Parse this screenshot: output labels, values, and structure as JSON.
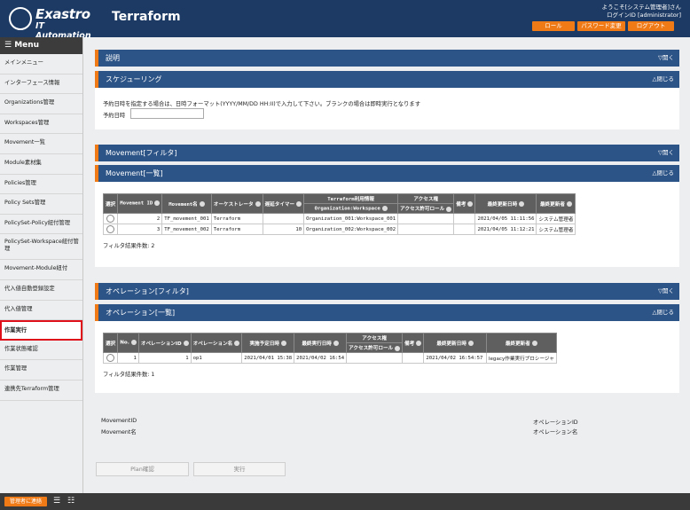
{
  "app": {
    "logo_line1": "Exastro",
    "logo_line2": "IT Automation",
    "title": "Terraform"
  },
  "user": {
    "welcome": "ようこそ[システム管理者]さん",
    "login": "ログインID [administrator]"
  },
  "header_buttons": {
    "role": "ロール",
    "password": "パスワード変更",
    "logout": "ログアウト"
  },
  "menu": {
    "title": "Menu",
    "items": [
      "メインメニュー",
      "インターフェース情報",
      "Organizations管理",
      "Workspaces管理",
      "Movement一覧",
      "Module素材集",
      "Policies管理",
      "Policy Sets管理",
      "PolicySet-Policy紐付管理",
      "PolicySet-Workspace紐付管理",
      "Movement-Module紐付",
      "代入値自動登録設定",
      "代入値管理",
      "作業実行",
      "作業状態確認",
      "作業管理",
      "連携先Terraform管理"
    ]
  },
  "footer": {
    "contact": "管理者に連絡"
  },
  "sections": {
    "desc": "説明",
    "schedule": "スケジューリング",
    "mv_filter": "Movement[フィルタ]",
    "mv_list": "Movement[一覧]",
    "op_filter": "オペレーション[フィルタ]",
    "op_list": "オペレーション[一覧]",
    "open": "▽開く",
    "close": "△閉じる"
  },
  "schedule": {
    "note": "予約日時を指定する場合は、日時フォーマット(YYYY/MM/DD HH:II)で入力して下さい。ブランクの場合は即時実行となります",
    "label": "予約日時",
    "value": ""
  },
  "movement_table": {
    "headers": {
      "select": "選択",
      "id": "Movement ID",
      "name": "Movement名",
      "orch": "オーケストレータ",
      "delay": "遅延タイマー",
      "tf_info": "Terraform利用情報",
      "org_ws": "Organization:Workspace",
      "access": "アクセス権",
      "access_role": "アクセス許可ロール",
      "remarks": "備考",
      "updated": "最終更新日時",
      "updater": "最終更新者"
    },
    "rows": [
      {
        "id": "2",
        "name": "TF_movement_001",
        "orch": "Terraform",
        "delay": "",
        "org_ws": "Organization_001:Workspace_001",
        "access_role": "",
        "remarks": "",
        "updated": "2021/04/05 11:11:56",
        "updater": "システム管理者"
      },
      {
        "id": "3",
        "name": "TF_movement_002",
        "orch": "Terraform",
        "delay": "10",
        "org_ws": "Organization_002:Workspace_002",
        "access_role": "",
        "remarks": "",
        "updated": "2021/04/05 11:12:21",
        "updater": "システム管理者"
      }
    ],
    "count": "フィルタ結果件数: 2"
  },
  "operation_table": {
    "headers": {
      "select": "選択",
      "no": "No.",
      "op_id": "オペレーションID",
      "op_name": "オペレーション名",
      "planned": "実施予定日時",
      "last_run": "最終実行日時",
      "access": "アクセス権",
      "access_role": "アクセス許可ロール",
      "remarks": "備考",
      "updated": "最終更新日時",
      "updater": "最終更新者"
    },
    "rows": [
      {
        "no": "1",
        "op_id": "1",
        "op_name": "op1",
        "planned": "2021/04/01 15:38",
        "last_run": "2021/04/02 16:54",
        "access_role": "",
        "remarks": "",
        "updated": "2021/04/02 16:54:57",
        "updater": "legacy作業実行プロシージャ"
      }
    ],
    "count": "フィルタ結果件数: 1"
  },
  "selection": {
    "movement_id": "MovementID",
    "movement_name": "Movement名",
    "operation_id": "オペレーションID",
    "operation_name": "オペレーション名"
  },
  "actions": {
    "plan": "Plan確認",
    "execute": "実行"
  }
}
